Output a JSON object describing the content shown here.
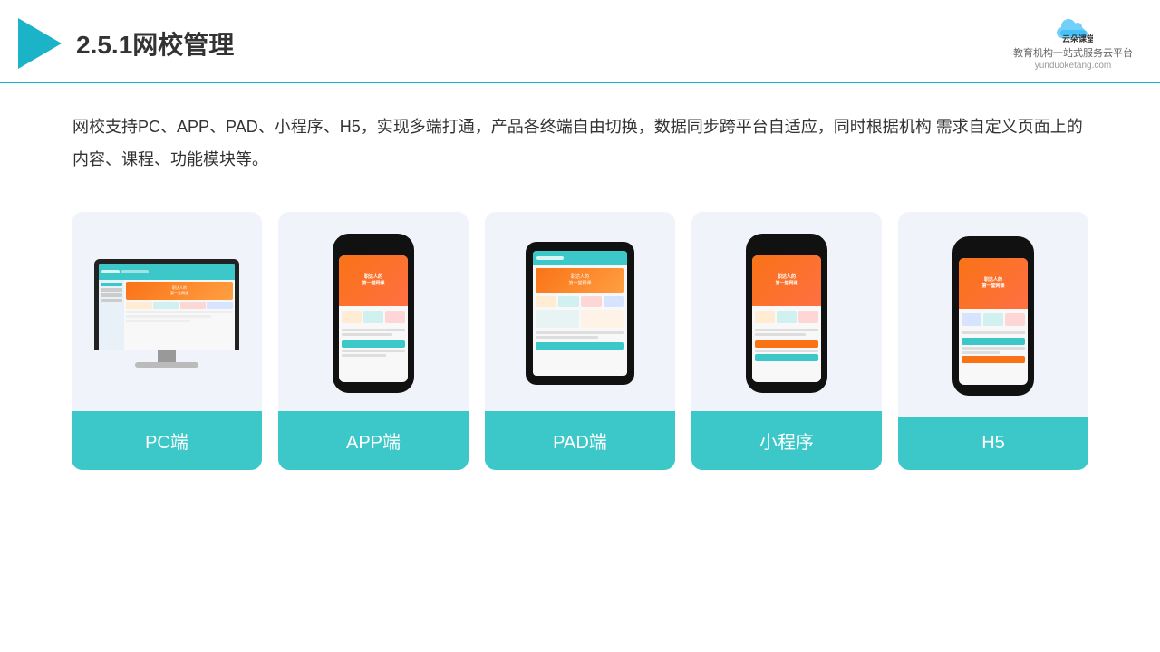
{
  "header": {
    "title": "2.5.1网校管理",
    "brand": {
      "name": "云朵课堂",
      "url": "yunduoketang.com",
      "slogan": "教育机构一站\n式服务云平台"
    }
  },
  "description": "网校支持PC、APP、PAD、小程序、H5，实现多端打通，产品各终端自由切换，数据同步跨平台自适应，同时根据机构\n需求自定义页面上的内容、课程、功能模块等。",
  "cards": [
    {
      "id": "pc",
      "label": "PC端",
      "type": "pc"
    },
    {
      "id": "app",
      "label": "APP端",
      "type": "phone"
    },
    {
      "id": "pad",
      "label": "PAD端",
      "type": "tablet"
    },
    {
      "id": "miniprogram",
      "label": "小程序",
      "type": "phone"
    },
    {
      "id": "h5",
      "label": "H5",
      "type": "phone"
    }
  ],
  "colors": {
    "teal": "#3cc8c8",
    "orange": "#f97316",
    "dark": "#333",
    "lightbg": "#f0f4fa"
  }
}
